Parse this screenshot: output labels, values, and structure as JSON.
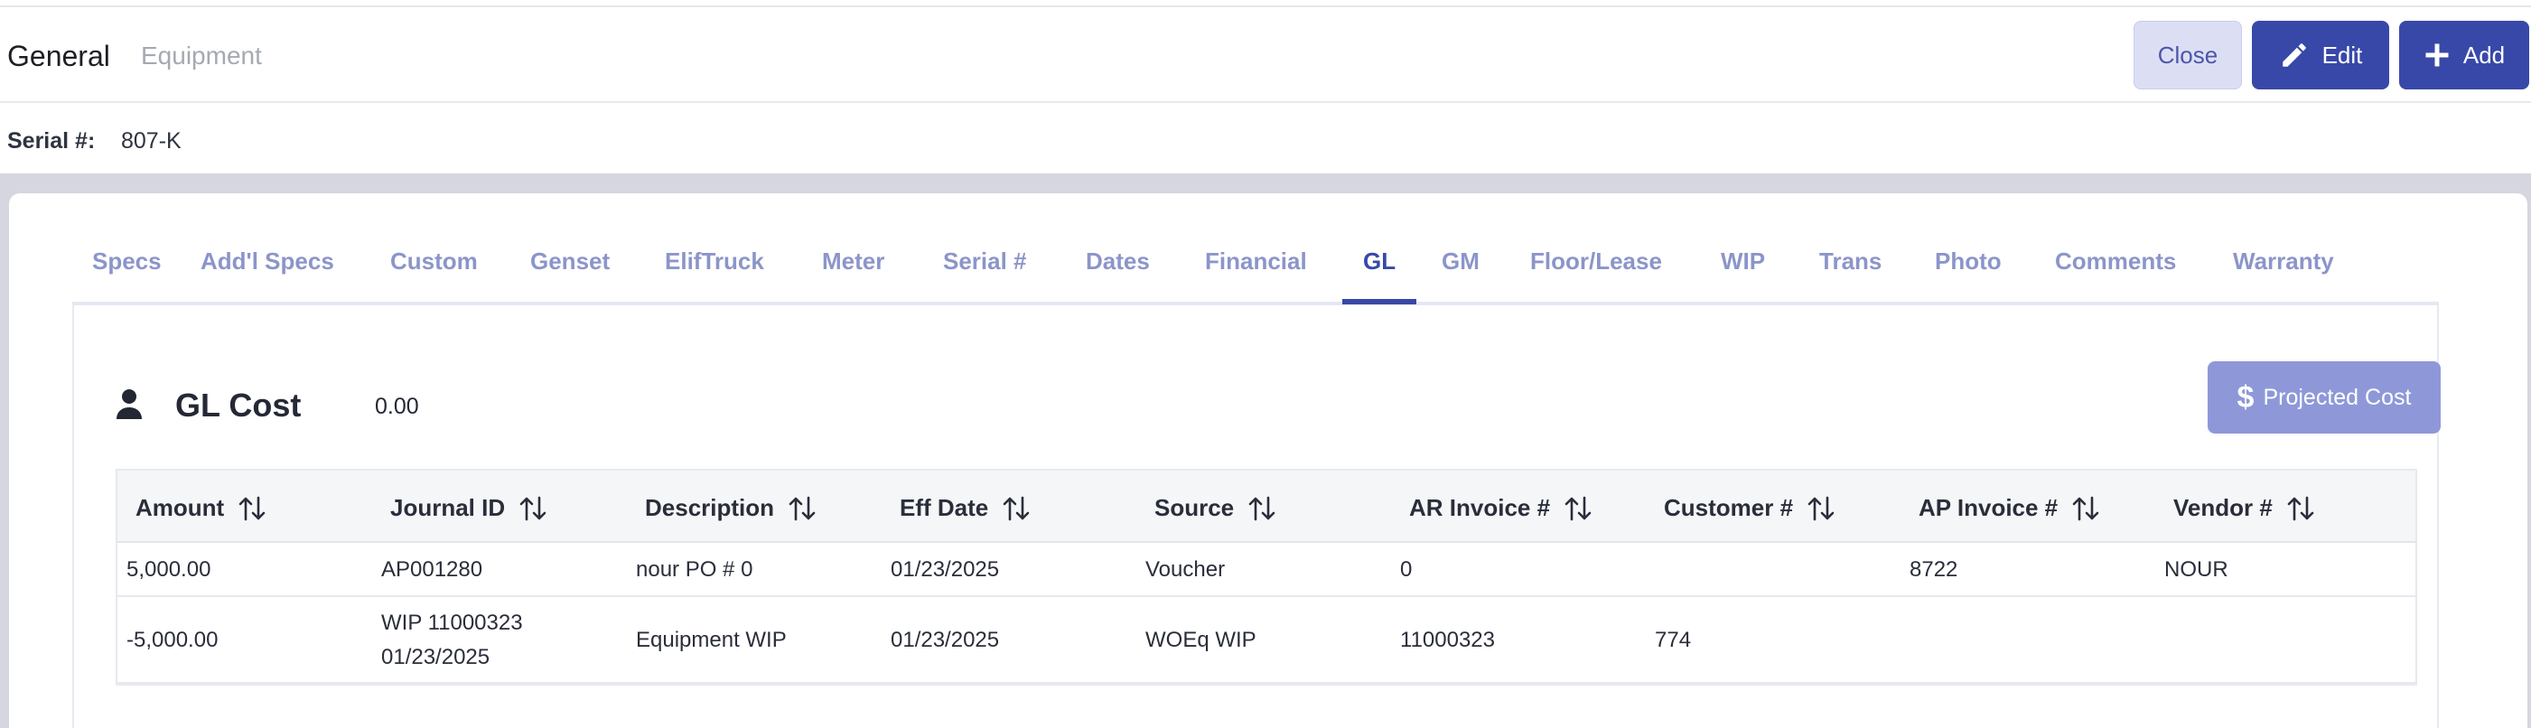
{
  "header": {
    "title": "General",
    "subtitle": "Equipment",
    "close_label": "Close",
    "edit_label": "Edit",
    "add_label": "Add"
  },
  "serial": {
    "label": "Serial #:",
    "value": "807-K"
  },
  "tabs": [
    {
      "label": "Specs"
    },
    {
      "label": "Add'l Specs"
    },
    {
      "label": "Custom"
    },
    {
      "label": "Genset"
    },
    {
      "label": "ElifTruck"
    },
    {
      "label": "Meter"
    },
    {
      "label": "Serial #"
    },
    {
      "label": "Dates"
    },
    {
      "label": "Financial"
    },
    {
      "label": "GL",
      "active": true
    },
    {
      "label": "GM"
    },
    {
      "label": "Floor/Lease"
    },
    {
      "label": "WIP"
    },
    {
      "label": "Trans"
    },
    {
      "label": "Photo"
    },
    {
      "label": "Comments"
    },
    {
      "label": "Warranty"
    }
  ],
  "gl": {
    "title": "GL Cost",
    "value": "0.00",
    "projected_label": "Projected Cost"
  },
  "table": {
    "columns": [
      "Amount",
      "Journal ID",
      "Description",
      "Eff Date",
      "Source",
      "AR Invoice #",
      "Customer #",
      "AP Invoice #",
      "Vendor #"
    ],
    "rows": [
      [
        "5,000.00",
        "AP001280",
        "nour PO # 0",
        "01/23/2025",
        "Voucher",
        "0",
        "",
        "8722",
        "NOUR"
      ],
      [
        "-5,000.00",
        "WIP 11000323 01/23/2025",
        "Equipment WIP",
        "01/23/2025",
        "WOEq WIP",
        "11000323",
        "774",
        "",
        ""
      ]
    ]
  },
  "colors": {
    "accent": "#3848a8",
    "tab_inactive": "#8c95c9",
    "close_bg": "#dcdff4",
    "projected_bg": "#8e98d8"
  }
}
